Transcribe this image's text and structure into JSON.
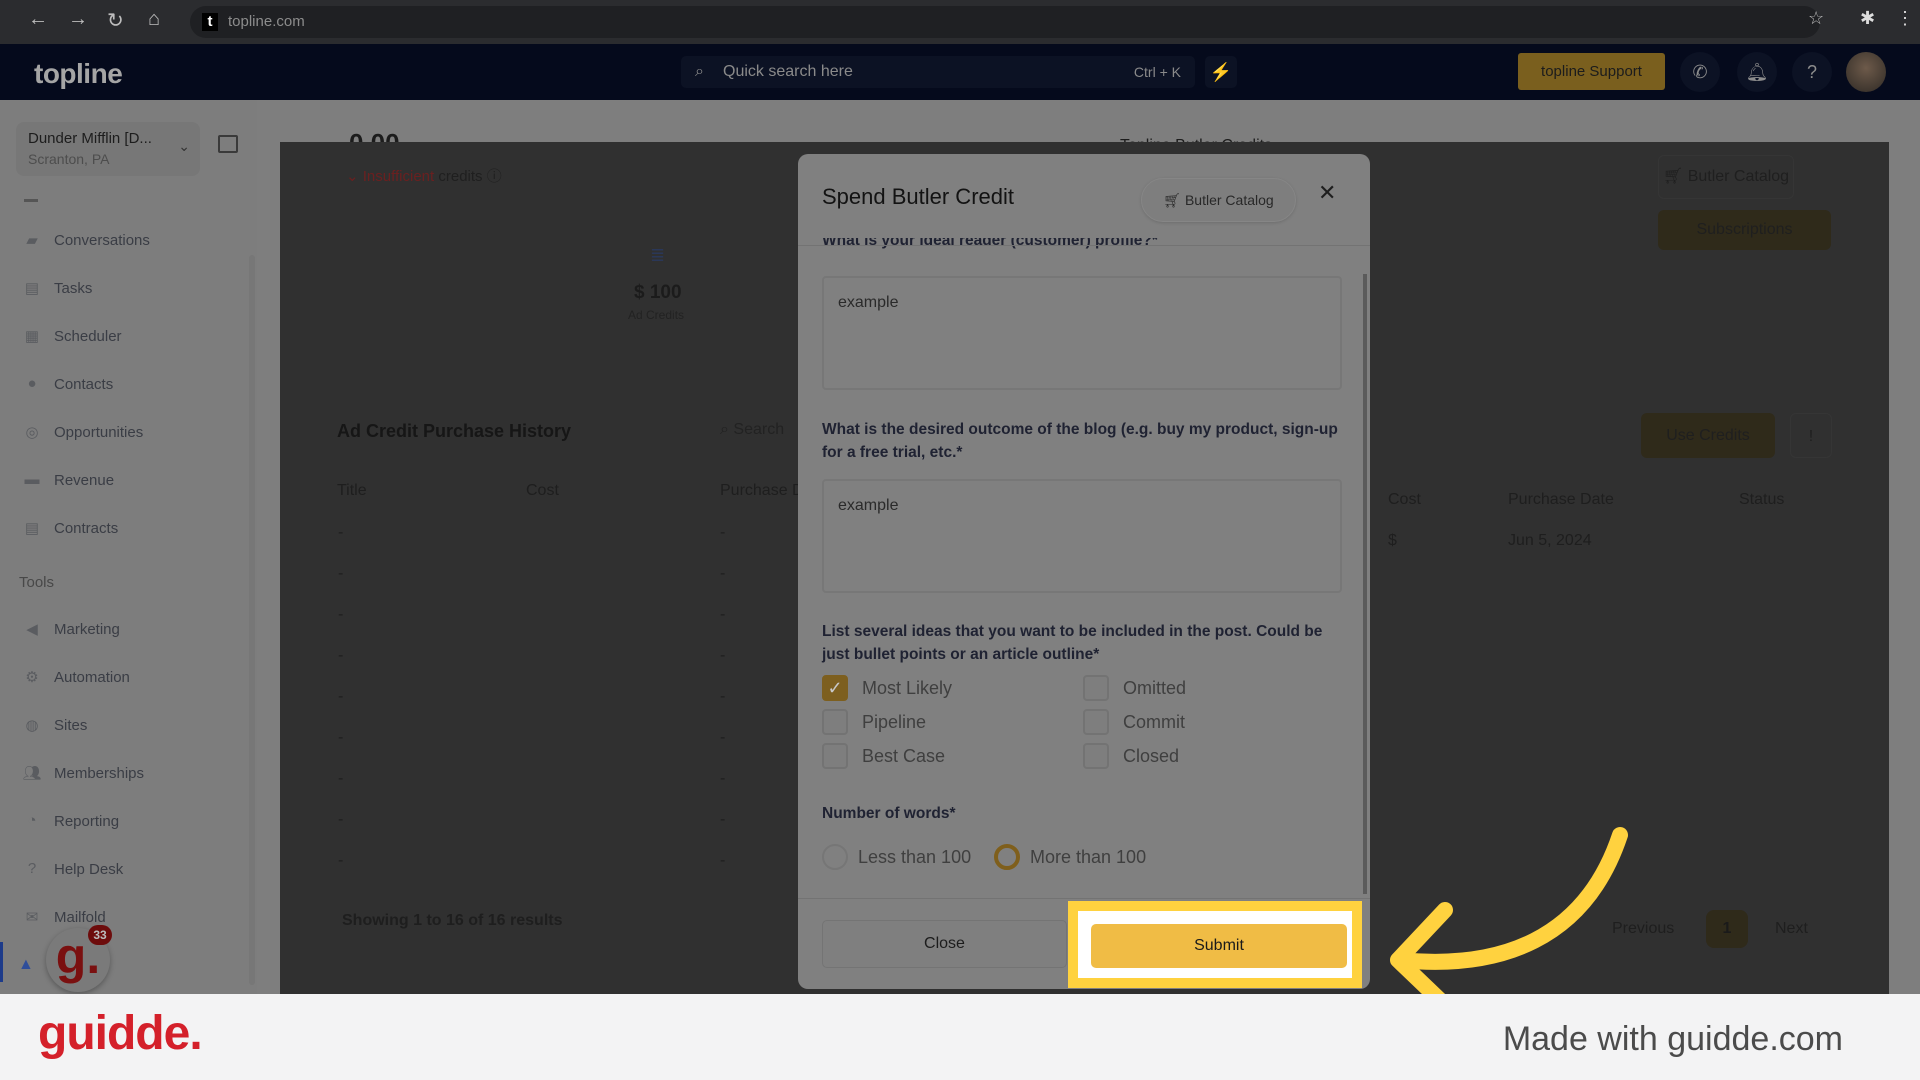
{
  "browser": {
    "url": "topline.com",
    "icons": [
      "back-icon",
      "forward-icon",
      "reload-icon",
      "home-icon",
      "star-icon",
      "extensions-icon",
      "menu-icon"
    ]
  },
  "header": {
    "logo": "topline",
    "search_placeholder": "Quick search here",
    "search_shortcut": "Ctrl + K",
    "support_label": "topline Support"
  },
  "sidebar": {
    "account_name": "Dunder Mifflin [D...",
    "account_location": "Scranton, PA",
    "items": [
      {
        "label": "Conversations"
      },
      {
        "label": "Tasks"
      },
      {
        "label": "Scheduler"
      },
      {
        "label": "Contacts"
      },
      {
        "label": "Opportunities"
      },
      {
        "label": "Revenue"
      },
      {
        "label": "Contracts"
      }
    ],
    "tools_heading": "Tools",
    "tools": [
      {
        "label": "Marketing"
      },
      {
        "label": "Automation"
      },
      {
        "label": "Sites"
      },
      {
        "label": "Memberships"
      },
      {
        "label": "Reporting"
      },
      {
        "label": "Help Desk"
      },
      {
        "label": "Mailfold"
      }
    ],
    "guidde_badge_count": "33"
  },
  "background": {
    "balance": "0.00",
    "insufficient": "Insufficient",
    "credits": "credits",
    "ad_credits_value": "$ 100",
    "ad_credits_label": "Ad Credits",
    "section_title": "Topline Butler Credits",
    "butler_catalog": "Butler Catalog",
    "subscriptions": "Subscriptions",
    "history_title": "Ad Credit Purchase History",
    "search_placeholder": "Search",
    "use_credits": "Use Credits",
    "left_columns": [
      "Title",
      "Cost",
      "Purchase D"
    ],
    "right_columns": [
      "Cost",
      "Purchase Date",
      "Status"
    ],
    "right_row": {
      "cost": "$",
      "date": "Jun 5, 2024"
    },
    "dash": "-",
    "showing": "Showing 1 to 16 of 16 results",
    "pagination": {
      "previous": "Previous",
      "page": "1",
      "next": "Next"
    }
  },
  "modal": {
    "title": "Spend Butler Credit",
    "catalog_button": "Butler Catalog",
    "q1": "What is your ideal reader (customer) profile?*",
    "a1": "example",
    "q2": "What is the desired outcome of the blog (e.g. buy my product, sign-up for a free trial, etc.*",
    "a2": "example",
    "q3": "List several ideas that you want to be included in the post. Could be just bullet points or an article outline*",
    "options": [
      {
        "label": "Most Likely",
        "checked": true
      },
      {
        "label": "Omitted",
        "checked": false
      },
      {
        "label": "Pipeline",
        "checked": false
      },
      {
        "label": "Commit",
        "checked": false
      },
      {
        "label": "Best Case",
        "checked": false
      },
      {
        "label": "Closed",
        "checked": false
      }
    ],
    "q4": "Number of words*",
    "radios": [
      {
        "label": "Less than 100",
        "selected": false
      },
      {
        "label": "More than 100",
        "selected": true
      }
    ],
    "close": "Close",
    "submit": "Submit"
  },
  "footer": {
    "logo": "guidde.",
    "made_with": "Made with guidde.com"
  },
  "colors": {
    "accent": "#f0bc45",
    "highlight": "#ffd23f",
    "guidde_red": "#d4202a"
  }
}
